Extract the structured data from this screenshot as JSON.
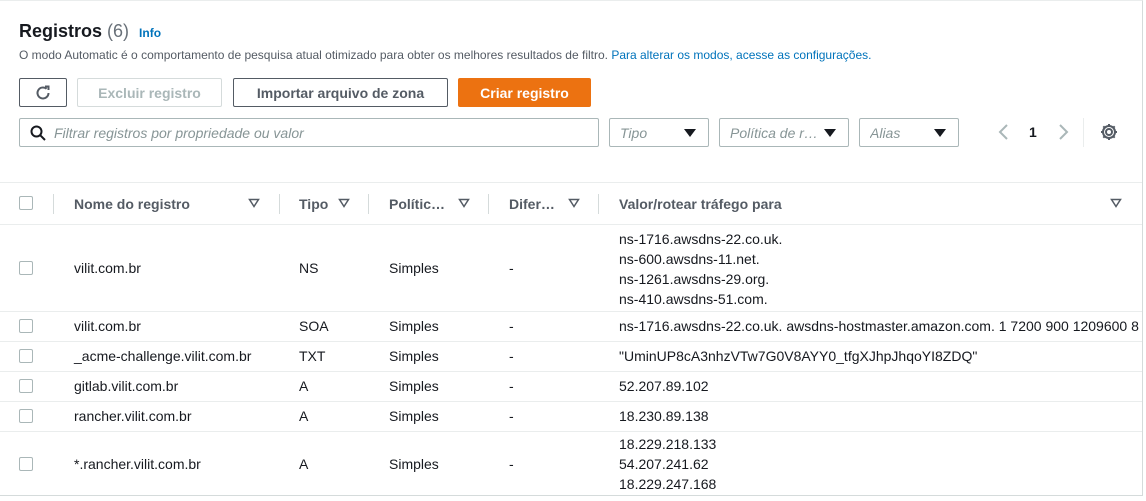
{
  "header": {
    "title": "Registros",
    "count": "(6)",
    "info": "Info",
    "description": "O modo Automatic é o comportamento de pesquisa atual otimizado para obter os melhores resultados de filtro.",
    "description_link": "Para alterar os modos, acesse as configurações."
  },
  "toolbar": {
    "delete_label": "Excluir registro",
    "import_label": "Importar arquivo de zona",
    "create_label": "Criar registro"
  },
  "filters": {
    "search_placeholder": "Filtrar registros por propriedade ou valor",
    "type_placeholder": "Tipo",
    "policy_placeholder": "Política de r…",
    "alias_placeholder": "Alias"
  },
  "pagination": {
    "current_page": "1"
  },
  "table": {
    "columns": [
      "Nome do registro",
      "Tipo",
      "Polític…",
      "Difer…",
      "Valor/rotear tráfego para"
    ],
    "rows": [
      {
        "name": "vilit.com.br",
        "type": "NS",
        "policy": "Simples",
        "diff": "-",
        "values": [
          "ns-1716.awsdns-22.co.uk.",
          "ns-600.awsdns-11.net.",
          "ns-1261.awsdns-29.org.",
          "ns-410.awsdns-51.com."
        ]
      },
      {
        "name": "vilit.com.br",
        "type": "SOA",
        "policy": "Simples",
        "diff": "-",
        "values": [
          "ns-1716.awsdns-22.co.uk. awsdns-hostmaster.amazon.com. 1 7200 900 1209600 8"
        ]
      },
      {
        "name": "_acme-challenge.vilit.com.br",
        "type": "TXT",
        "policy": "Simples",
        "diff": "-",
        "values": [
          "\"UminUP8cA3nhzVTw7G0V8AYY0_tfgXJhpJhqoYI8ZDQ\""
        ]
      },
      {
        "name": "gitlab.vilit.com.br",
        "type": "A",
        "policy": "Simples",
        "diff": "-",
        "values": [
          "52.207.89.102"
        ]
      },
      {
        "name": "rancher.vilit.com.br",
        "type": "A",
        "policy": "Simples",
        "diff": "-",
        "values": [
          "18.230.89.138"
        ]
      },
      {
        "name": "*.rancher.vilit.com.br",
        "type": "A",
        "policy": "Simples",
        "diff": "-",
        "values": [
          "18.229.218.133",
          "54.207.241.62",
          "18.229.247.168"
        ]
      }
    ]
  }
}
